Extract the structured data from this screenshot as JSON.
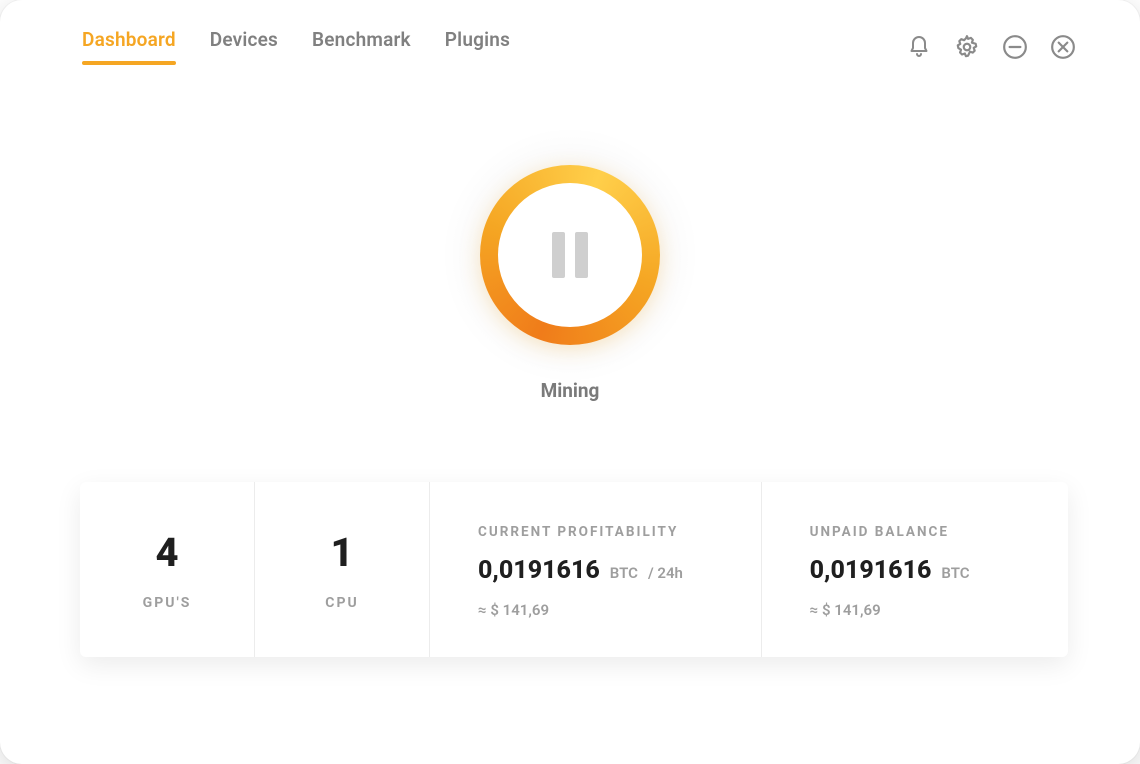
{
  "colors": {
    "accent": "#f5a623"
  },
  "nav": {
    "tabs": [
      {
        "label": "Dashboard",
        "active": true
      },
      {
        "label": "Devices",
        "active": false
      },
      {
        "label": "Benchmark",
        "active": false
      },
      {
        "label": "Plugins",
        "active": false
      }
    ]
  },
  "topIcons": {
    "bell": "bell-icon",
    "gear": "gear-icon",
    "minimize": "minimize-icon",
    "close": "close-icon"
  },
  "center": {
    "statusLabel": "Mining",
    "pauseIcon": "pause-icon"
  },
  "stats": {
    "gpu": {
      "count": "4",
      "label": "GPU'S"
    },
    "cpu": {
      "count": "1",
      "label": "CPU"
    },
    "profitability": {
      "heading": "CURRENT PROFITABILITY",
      "valueBtc": "0,0191616",
      "unit": "BTC",
      "per": "/ 24h",
      "approx": "≈ $ 141,69"
    },
    "balance": {
      "heading": "UNPAID BALANCE",
      "valueBtc": "0,0191616",
      "unit": "BTC",
      "approx": "≈ $ 141,69"
    }
  }
}
